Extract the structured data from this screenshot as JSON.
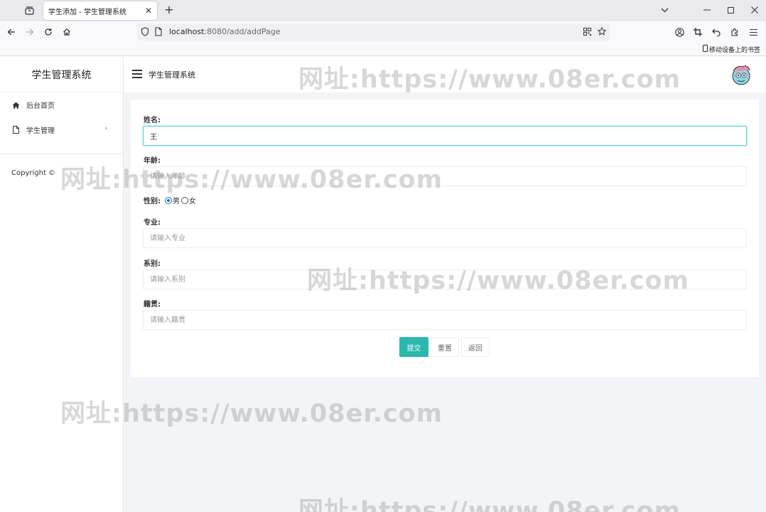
{
  "browser": {
    "tab_title": "学生添加 - 学生管理系统",
    "url_host": "localhost",
    "url_path": ":8080/add/addPage",
    "bookmark_label": "移动设备上的书签"
  },
  "sidebar": {
    "brand": "学生管理系统",
    "items": [
      {
        "label": "后台首页",
        "icon": "home-icon"
      },
      {
        "label": "学生管理",
        "icon": "document-icon"
      }
    ],
    "copyright": "Copyright ©"
  },
  "header": {
    "title": "学生管理系统"
  },
  "form": {
    "name": {
      "label": "姓名:",
      "value": "王",
      "placeholder": ""
    },
    "age": {
      "label": "年龄:",
      "value": "",
      "placeholder": "请输入年龄"
    },
    "gender": {
      "label": "性别:",
      "options": [
        "男",
        "女"
      ],
      "selected": "男"
    },
    "major": {
      "label": "专业:",
      "value": "",
      "placeholder": "请输入专业"
    },
    "department": {
      "label": "系别:",
      "value": "",
      "placeholder": "请输入系别"
    },
    "hometown": {
      "label": "籍贯:",
      "value": "",
      "placeholder": "请输入籍贯"
    },
    "buttons": {
      "submit": "提交",
      "reset": "重置",
      "back": "返回"
    }
  },
  "watermark": "网址:https://www.08er.com",
  "colors": {
    "primary": "#2bb8ad",
    "focus_border": "#5fd2cf",
    "content_bg": "#f3f4f8"
  }
}
